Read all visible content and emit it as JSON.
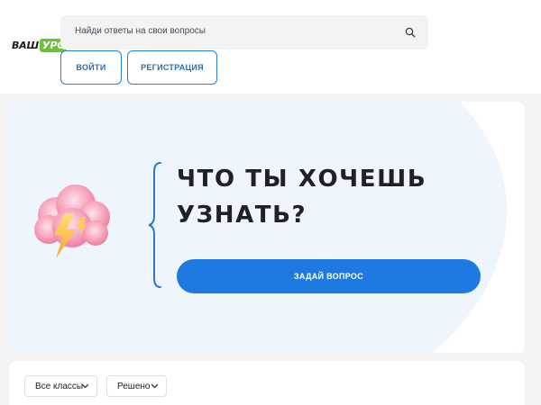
{
  "header": {
    "logo": {
      "left": "ВАШ",
      "right": "УРОК"
    },
    "search": {
      "placeholder": "Найди ответы на свои вопросы",
      "icon": "search-icon"
    },
    "login_label": "ВОЙТИ",
    "register_label": "РЕГИСТРАЦИЯ"
  },
  "hero": {
    "title_line1": "ЧТО ТЫ ХОЧЕШЬ",
    "title_line2": "УЗНАТЬ?",
    "ask_label": "ЗАДАЙ ВОПРОС",
    "illustration": "thunder-cloud-icon"
  },
  "filters": {
    "class_filter": {
      "label": "Все классы",
      "icon": "chevron-down-icon"
    },
    "status_filter": {
      "label": "Решено",
      "icon": "chevron-down-icon"
    }
  },
  "colors": {
    "accent": "#1e79e0",
    "outline": "#2a83cd",
    "logo_green": "#6cc03a",
    "hero_bg": "#eef5fd",
    "page_bg": "#f3f4f6"
  }
}
